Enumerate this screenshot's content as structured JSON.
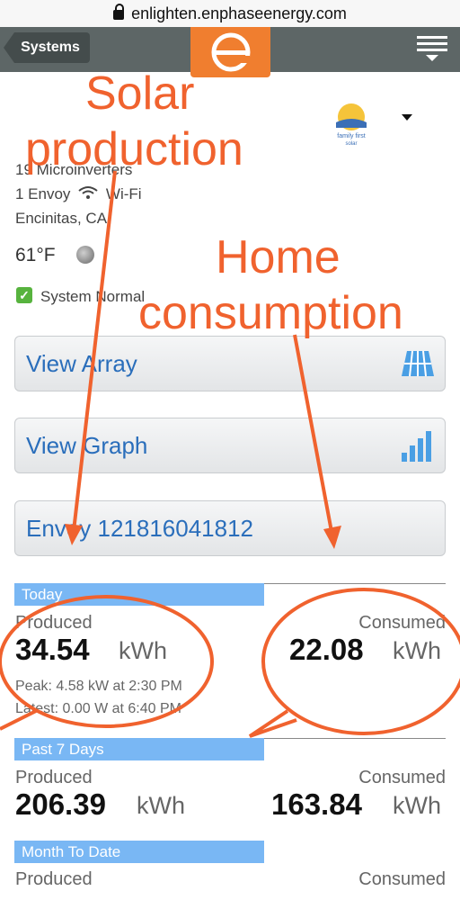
{
  "browser": {
    "url": "enlighten.enphaseenergy.com"
  },
  "nav": {
    "back_label": "Systems"
  },
  "system": {
    "microinverters": "19 Microinverters",
    "envoy_count": "1 Envoy",
    "connection": "Wi-Fi",
    "location": "Encinitas, CA",
    "temperature": "61°F",
    "status": "System Normal",
    "brand_logo_text": "family first solar"
  },
  "buttons": {
    "view_array": "View Array",
    "view_graph": "View Graph",
    "envoy": "Envoy 121816041812"
  },
  "today": {
    "header": "Today",
    "produced_label": "Produced",
    "produced_value": "34.54",
    "consumed_label": "Consumed",
    "consumed_value": "22.08",
    "unit": "kWh",
    "peak": "Peak: 4.58  kW at 2:30 PM",
    "latest": "Latest: 0.00  W at 6:40 PM"
  },
  "past7": {
    "header": "Past 7 Days",
    "produced_label": "Produced",
    "produced_value": "206.39",
    "consumed_label": "Consumed",
    "consumed_value": "163.84",
    "unit": "kWh"
  },
  "month": {
    "header": "Month To Date",
    "produced_label": "Produced",
    "consumed_label": "Consumed"
  },
  "annotations": {
    "solar": "Solar\nproduction",
    "home": "Home\nconsumption",
    "color": "#f0622e"
  }
}
